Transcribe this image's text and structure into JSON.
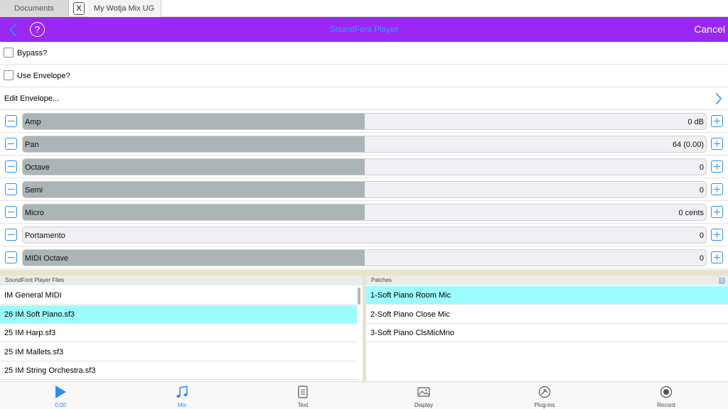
{
  "tabs": {
    "documents": "Documents",
    "close": "X",
    "current": "My Wotja Mix UG"
  },
  "header": {
    "title": "SoundFont Player",
    "help": "?",
    "cancel": "Cancel"
  },
  "options": {
    "bypass": "Bypass?",
    "use_envelope": "Use Envelope?",
    "edit_envelope": "Edit Envelope..."
  },
  "sliders": [
    {
      "label": "Amp",
      "value": "0 dB",
      "level": 0.5
    },
    {
      "label": "Pan",
      "value": "64 (0.00)",
      "level": 0.5
    },
    {
      "label": "Octave",
      "value": "0",
      "level": 0.5
    },
    {
      "label": "Semi",
      "value": "0",
      "level": 0.5
    },
    {
      "label": "Micro",
      "value": "0 cents",
      "level": 0.5
    },
    {
      "label": "Portamento",
      "value": "0",
      "level": 0
    },
    {
      "label": "MIDI Octave",
      "value": "0",
      "level": 0.5
    }
  ],
  "files_panel": {
    "title": "SoundFont Player Files",
    "items": [
      {
        "label": "IM General MIDI",
        "selected": false
      },
      {
        "label": "26 IM Soft Piano.sf3",
        "selected": true
      },
      {
        "label": "25 IM Harp.sf3",
        "selected": false
      },
      {
        "label": "25 IM Mallets.sf3",
        "selected": false
      },
      {
        "label": "25 IM String Orchestra.sf3",
        "selected": false
      }
    ]
  },
  "patches_panel": {
    "title": "Patches",
    "items": [
      {
        "label": "1-Soft Piano Room Mic",
        "selected": true
      },
      {
        "label": "2-Soft Piano Close Mic",
        "selected": false
      },
      {
        "label": "3-Soft Piano ClsMicMno",
        "selected": false
      }
    ]
  },
  "tabbar": {
    "play": "0:00",
    "mix": "Mix",
    "text": "Text",
    "display": "Display",
    "plugins": "Plug-ins",
    "record": "Record"
  },
  "colors": {
    "header": "#9b27f2",
    "accent": "#2b8ff1",
    "selection": "#9cfbfd",
    "slider_fill": "#abb4b6"
  }
}
